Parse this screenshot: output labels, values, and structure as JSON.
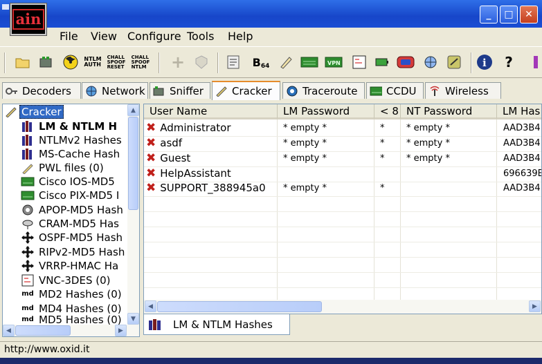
{
  "window": {
    "logo_text": "ain",
    "logo_icon": "cain-logo"
  },
  "menu": [
    "File",
    "View",
    "Configure",
    "Tools",
    "Help"
  ],
  "toolbar": {
    "b64_label": "B",
    "b64_sub": "64",
    "ntlm_auth": "NTLM\nAUTH",
    "chall_spoof_reset": "CHALL\nSPOOF\nRESET",
    "chall_spoof_ntlm": "CHALL\nSPOOF\nNTLM"
  },
  "tabs": [
    {
      "label": "Decoders",
      "icon": "key-icon"
    },
    {
      "label": "Network",
      "icon": "globe-icon"
    },
    {
      "label": "Sniffer",
      "icon": "sniffer-icon"
    },
    {
      "label": "Cracker",
      "icon": "cracker-icon",
      "active": true
    },
    {
      "label": "Traceroute",
      "icon": "traceroute-icon"
    },
    {
      "label": "CCDU",
      "icon": "ccdu-icon"
    },
    {
      "label": "Wireless",
      "icon": "wireless-icon"
    }
  ],
  "tree": {
    "root": "Cracker",
    "items": [
      {
        "label": "LM & NTLM H",
        "bold": true,
        "icon": "books-icon"
      },
      {
        "label": "NTLMv2 Hashes",
        "icon": "books-icon"
      },
      {
        "label": "MS-Cache Hash",
        "icon": "books-icon"
      },
      {
        "label": "PWL files (0)",
        "icon": "pwl-icon"
      },
      {
        "label": "Cisco IOS-MD5",
        "icon": "cisco-icon"
      },
      {
        "label": "Cisco PIX-MD5 I",
        "icon": "cisco-icon"
      },
      {
        "label": "APOP-MD5 Hash",
        "icon": "apop-icon"
      },
      {
        "label": "CRAM-MD5 Has",
        "icon": "cram-icon"
      },
      {
        "label": "OSPF-MD5 Hash",
        "icon": "cross-arrows-icon"
      },
      {
        "label": "RIPv2-MD5 Hash",
        "icon": "cross-arrows-icon"
      },
      {
        "label": "VRRP-HMAC Ha",
        "icon": "cross-arrows-icon"
      },
      {
        "label": "VNC-3DES (0)",
        "icon": "vnc-icon"
      },
      {
        "label": "MD2 Hashes (0)",
        "icon": "md-icon"
      },
      {
        "label": "MD4 Hashes (0)",
        "icon": "md-icon"
      },
      {
        "label": "MD5 Hashes (0)",
        "icon": "md-icon"
      }
    ]
  },
  "grid": {
    "columns": [
      "User Name",
      "LM Password",
      "< 8",
      "NT Password",
      "LM Has"
    ],
    "rows": [
      {
        "user": "Administrator",
        "lm": "* empty *",
        "lt8": "*",
        "nt": "* empty *",
        "lmhash": "AAD3B4"
      },
      {
        "user": "asdf",
        "lm": "* empty *",
        "lt8": "*",
        "nt": "* empty *",
        "lmhash": "AAD3B4"
      },
      {
        "user": "Guest",
        "lm": "* empty *",
        "lt8": "*",
        "nt": "* empty *",
        "lmhash": "AAD3B4"
      },
      {
        "user": "HelpAssistant",
        "lm": "",
        "lt8": "",
        "nt": "",
        "lmhash": "696639E"
      },
      {
        "user": "SUPPORT_388945a0",
        "lm": "* empty *",
        "lt8": "*",
        "nt": "",
        "lmhash": "AAD3B4"
      }
    ]
  },
  "bottom_tab": {
    "label": "LM & NTLM Hashes"
  },
  "status": "http://www.oxid.it"
}
